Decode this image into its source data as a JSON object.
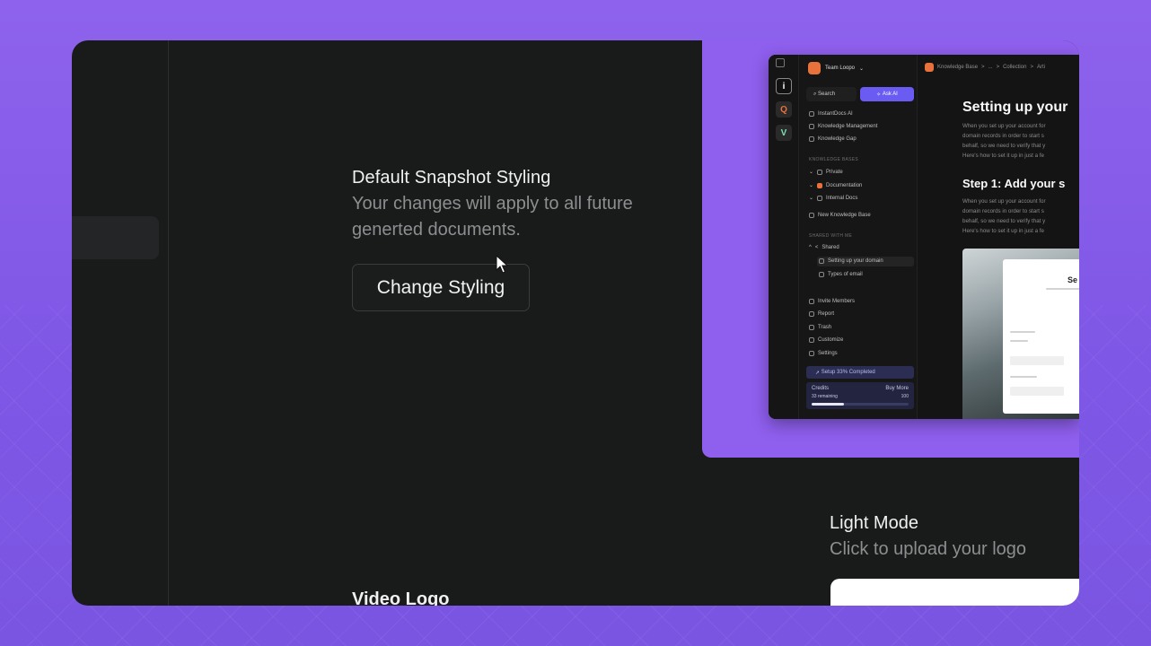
{
  "styling": {
    "title": "Default Snapshot Styling",
    "desc_line1": "Your changes will apply to all future",
    "desc_line2": "generted documents.",
    "button_label": "Change Styling"
  },
  "light_mode": {
    "title": "Light Mode",
    "desc": "Click to upload your logo"
  },
  "video_logo": {
    "title": "Video Logo"
  },
  "snapshot": {
    "team_name": "Team Loopo",
    "search_label": "Search",
    "ask_ai_label": "Ask AI",
    "nav": [
      "InstantDocs AI",
      "Knowledge Management",
      "Knowledge Gap"
    ],
    "kb_heading": "KNOWLEDGE BASES",
    "kb_items": [
      "Private",
      "Documentation",
      "Internal Docs"
    ],
    "new_kb": "New Knowledge Base",
    "shared_heading": "SHARED WITH ME",
    "shared_group": "Shared",
    "shared_items": [
      "Setting up your domain",
      "Types of email"
    ],
    "bottom_nav": [
      "Invite Members",
      "Report",
      "Trash",
      "Customize",
      "Settings"
    ],
    "setup_label": "Setup 33% Completed",
    "credits_label": "Credits",
    "buy_more": "Buy More",
    "remaining": "33 remaining",
    "credits_total": "100",
    "credits_fraction": 0.33,
    "breadcrumb": [
      "Knowledge Base",
      ">",
      "...",
      ">",
      "Collection",
      ">",
      "Arti"
    ],
    "doc_title": "Setting up your",
    "doc_para1": [
      "When you set up your account for",
      "domain records in order to start s",
      "behalf, so we need to verify that y",
      "Here's how to set it up in just a fe"
    ],
    "step_title": "Step 1: Add your s",
    "doc_para2": [
      "When you set up your account for",
      "domain records in order to start s",
      "behalf, so we need to verify that y",
      "Here's how to set it up in just a fe"
    ],
    "card_heading": "Se"
  },
  "colors": {
    "page_bg": "#8e62ec",
    "app_bg": "#191a1a",
    "accent": "#6a5cf2",
    "brand_orange": "#e8713c"
  }
}
